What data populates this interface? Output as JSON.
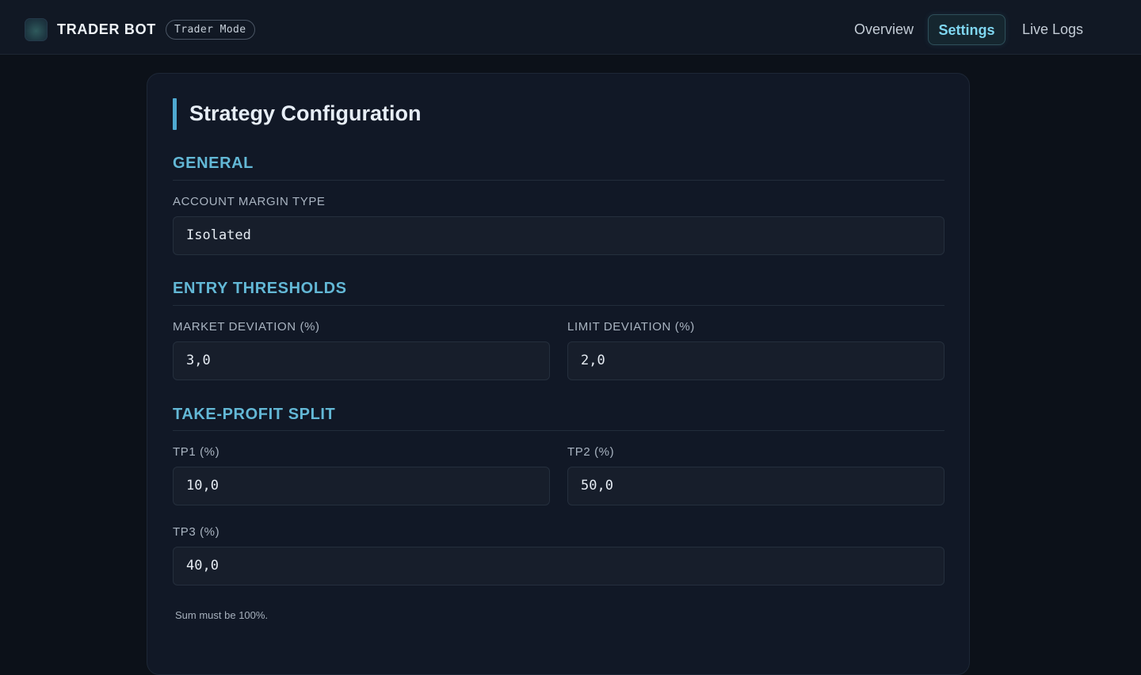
{
  "app": {
    "name": "TRADER BOT",
    "mode_badge": "Trader Mode"
  },
  "nav": {
    "items": [
      {
        "label": "Overview",
        "active": false
      },
      {
        "label": "Settings",
        "active": true
      },
      {
        "label": "Live Logs",
        "active": false
      }
    ]
  },
  "page": {
    "title": "Strategy Configuration"
  },
  "sections": {
    "general": {
      "title": "GENERAL",
      "account_margin_type": {
        "label": "ACCOUNT MARGIN TYPE",
        "value": "Isolated"
      }
    },
    "entry_thresholds": {
      "title": "ENTRY THRESHOLDS",
      "market_deviation": {
        "label": "MARKET DEVIATION (%)",
        "value": "3,0"
      },
      "limit_deviation": {
        "label": "LIMIT DEVIATION (%)",
        "value": "2,0"
      }
    },
    "take_profit_split": {
      "title": "TAKE-PROFIT SPLIT",
      "tp1": {
        "label": "TP1 (%)",
        "value": "10,0"
      },
      "tp2": {
        "label": "TP2 (%)",
        "value": "50,0"
      },
      "tp3": {
        "label": "TP3 (%)",
        "value": "40,0"
      },
      "hint": "Sum must be 100%."
    }
  },
  "colors": {
    "background": "#0c1119",
    "card": "#111826",
    "accent": "#63b8d6",
    "active_nav": "#7fd6f0"
  }
}
